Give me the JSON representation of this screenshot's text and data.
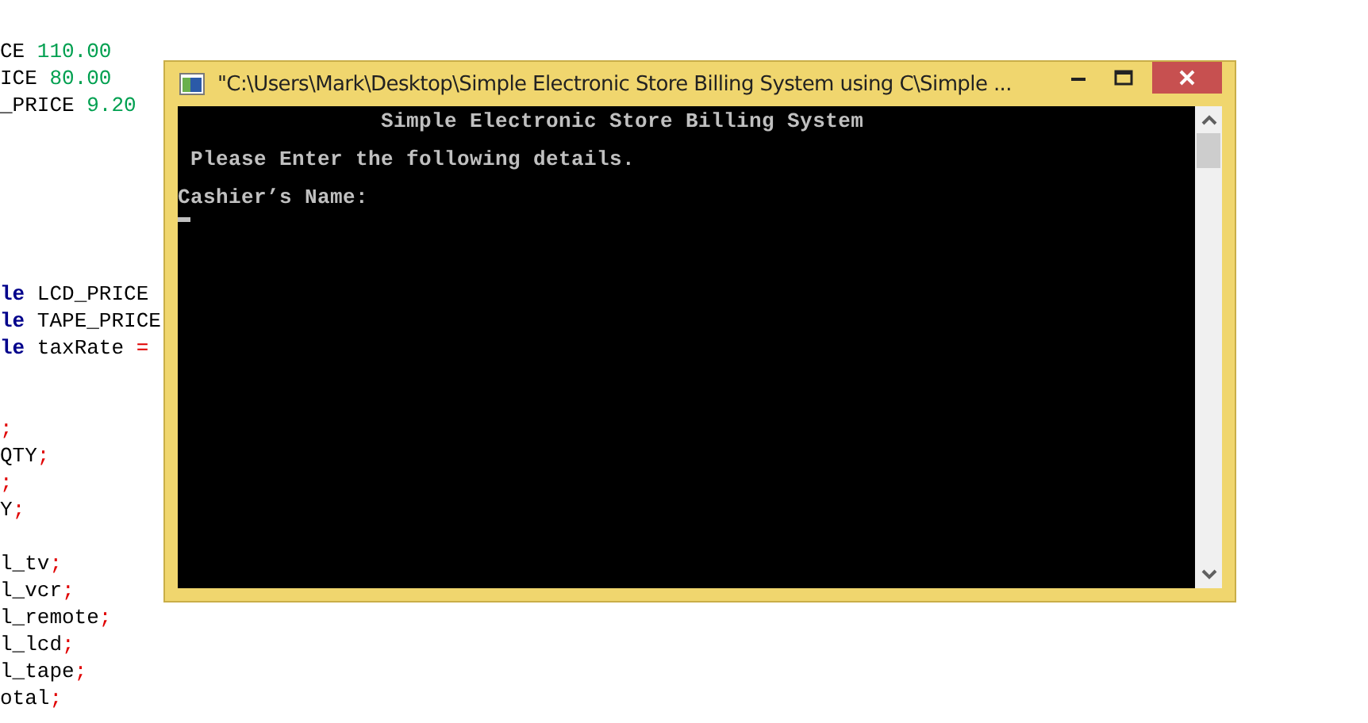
{
  "editor": {
    "blocks": [
      [
        [
          {
            "kind": "plain",
            "text": "CE "
          },
          {
            "kind": "number",
            "text": "110.00"
          }
        ],
        [
          {
            "kind": "plain",
            "text": "ICE "
          },
          {
            "kind": "number",
            "text": "80.00"
          }
        ],
        [
          {
            "kind": "plain",
            "text": "_PRICE "
          },
          {
            "kind": "number",
            "text": "9.20"
          }
        ]
      ],
      [
        [
          {
            "kind": "keyword",
            "text": "le"
          },
          {
            "kind": "plain",
            "text": " LCD_PRICE"
          }
        ],
        [
          {
            "kind": "keyword",
            "text": "le"
          },
          {
            "kind": "plain",
            "text": " TAPE_PRICE"
          }
        ],
        [
          {
            "kind": "keyword",
            "text": "le"
          },
          {
            "kind": "plain",
            "text": " taxRate "
          },
          {
            "kind": "punct",
            "text": "="
          }
        ]
      ],
      [
        [
          {
            "kind": "punct",
            "text": ";"
          }
        ],
        [
          {
            "kind": "plain",
            "text": "QTY"
          },
          {
            "kind": "punct",
            "text": ";"
          }
        ],
        [
          {
            "kind": "punct",
            "text": ";"
          }
        ],
        [
          {
            "kind": "plain",
            "text": "Y"
          },
          {
            "kind": "punct",
            "text": ";"
          }
        ]
      ],
      [
        [
          {
            "kind": "plain",
            "text": "l_tv"
          },
          {
            "kind": "punct",
            "text": ";"
          }
        ],
        [
          {
            "kind": "plain",
            "text": "l_vcr"
          },
          {
            "kind": "punct",
            "text": ";"
          }
        ],
        [
          {
            "kind": "plain",
            "text": "l_remote"
          },
          {
            "kind": "punct",
            "text": ";"
          }
        ],
        [
          {
            "kind": "plain",
            "text": "l_lcd"
          },
          {
            "kind": "punct",
            "text": ";"
          }
        ],
        [
          {
            "kind": "plain",
            "text": "l_tape"
          },
          {
            "kind": "punct",
            "text": ";"
          }
        ],
        [
          {
            "kind": "plain",
            "text": "otal"
          },
          {
            "kind": "punct",
            "text": ";"
          }
        ]
      ]
    ]
  },
  "console_window": {
    "title": "\"C:\\Users\\Mark\\Desktop\\Simple Electronic Store Billing System using C\\Simple ...",
    "lines": [
      {
        "kind": "text",
        "text": "                Simple Electronic Store Billing System"
      },
      {
        "kind": "blank"
      },
      {
        "kind": "text",
        "text": " Please Enter the following details."
      },
      {
        "kind": "blank"
      },
      {
        "kind": "text",
        "text": "Cashier’s Name:"
      },
      {
        "kind": "cursor"
      }
    ]
  }
}
